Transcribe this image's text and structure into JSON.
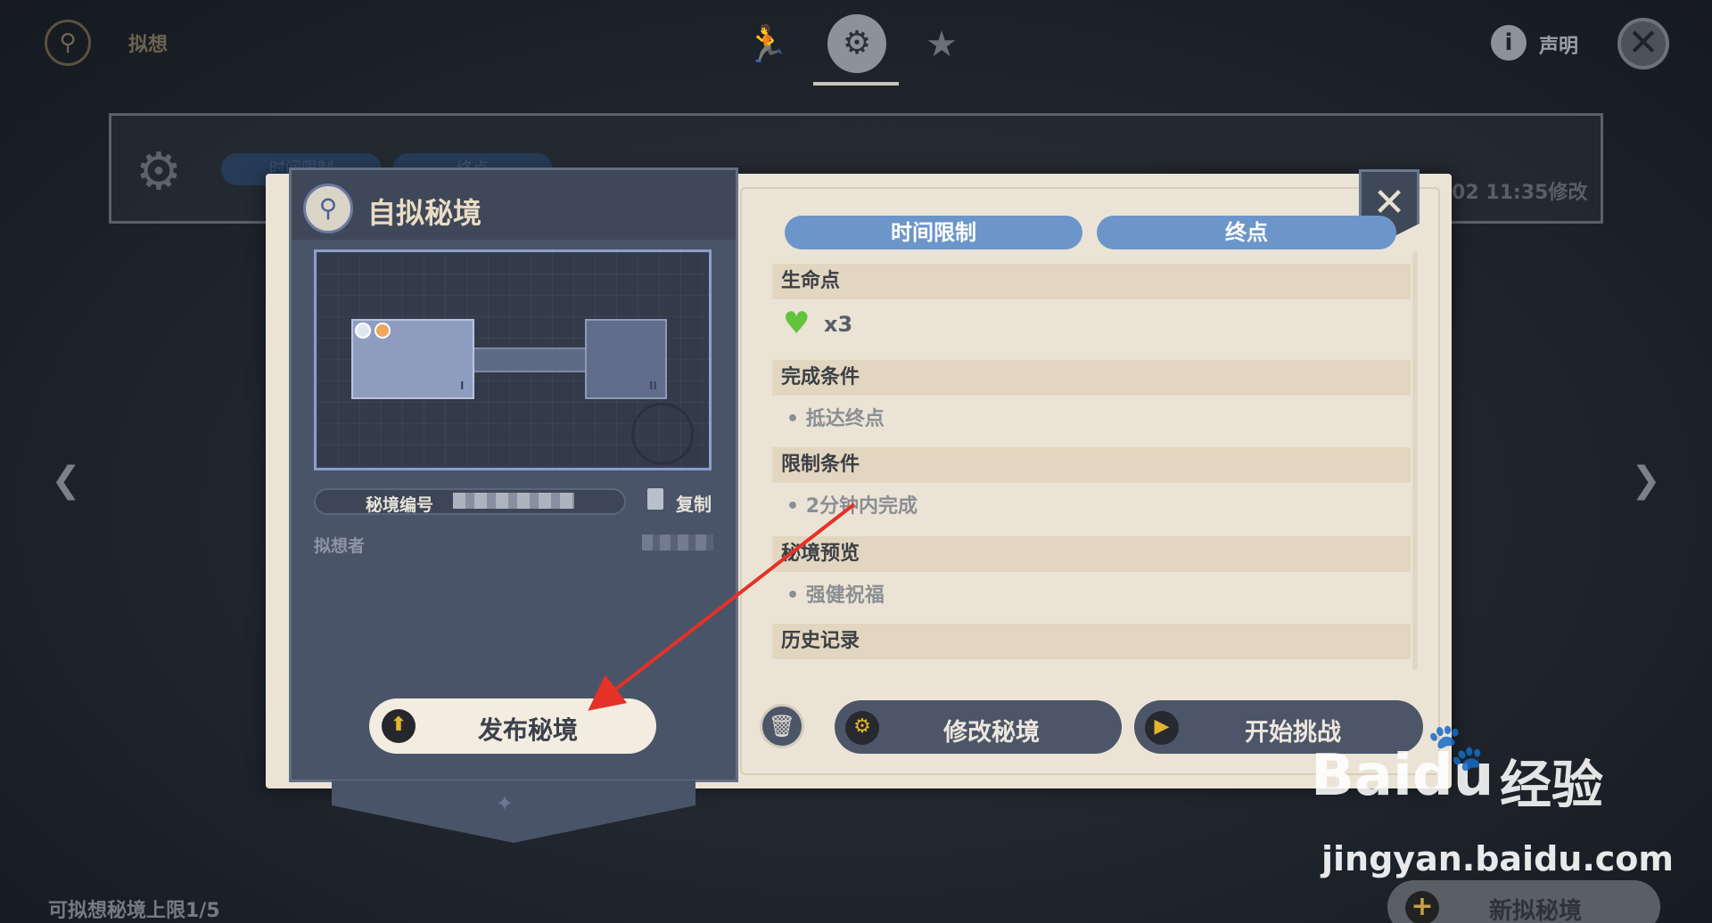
{
  "topbar": {
    "title": "拟想",
    "info_label": "声明"
  },
  "background_card": {
    "pill1": "时间限制",
    "pill2": "终点",
    "date_text": "/02 11:35修改"
  },
  "bottom": {
    "limit_text": "可拟想秘境上限1/5",
    "new_button": "新拟秘境"
  },
  "panel": {
    "title": "自拟秘境",
    "room_labels": [
      "I",
      "II"
    ],
    "id_label": "秘境编号",
    "copy_label": "复制",
    "author_label": "拟想者",
    "publish_button": "发布秘境"
  },
  "tabs": {
    "time_limit": "时间限制",
    "end_point": "终点"
  },
  "sections": {
    "life_points": {
      "header": "生命点",
      "count": "x3"
    },
    "completion": {
      "header": "完成条件",
      "item": "抵达终点"
    },
    "restriction": {
      "header": "限制条件",
      "item": "2分钟内完成"
    },
    "preview": {
      "header": "秘境预览",
      "item": "强健祝福"
    },
    "history": {
      "header": "历史记录"
    }
  },
  "buttons": {
    "modify": "修改秘境",
    "start": "开始挑战"
  },
  "watermark": {
    "brand": "Bai",
    "brand_suffix": "du",
    "cn": "经验",
    "url": "jingyan.baidu.com"
  },
  "colors": {
    "accent_blue": "#6c96ca",
    "cream": "#ebe4d6",
    "panel": "#4a5468",
    "annotation_arrow": "#e53127"
  },
  "icons": {
    "top_logo": "compass-eye-icon",
    "tab1": "running-icon",
    "tab2": "map-gear-icon",
    "tab3": "bookmark-star-icon",
    "heart": "heart-icon"
  }
}
